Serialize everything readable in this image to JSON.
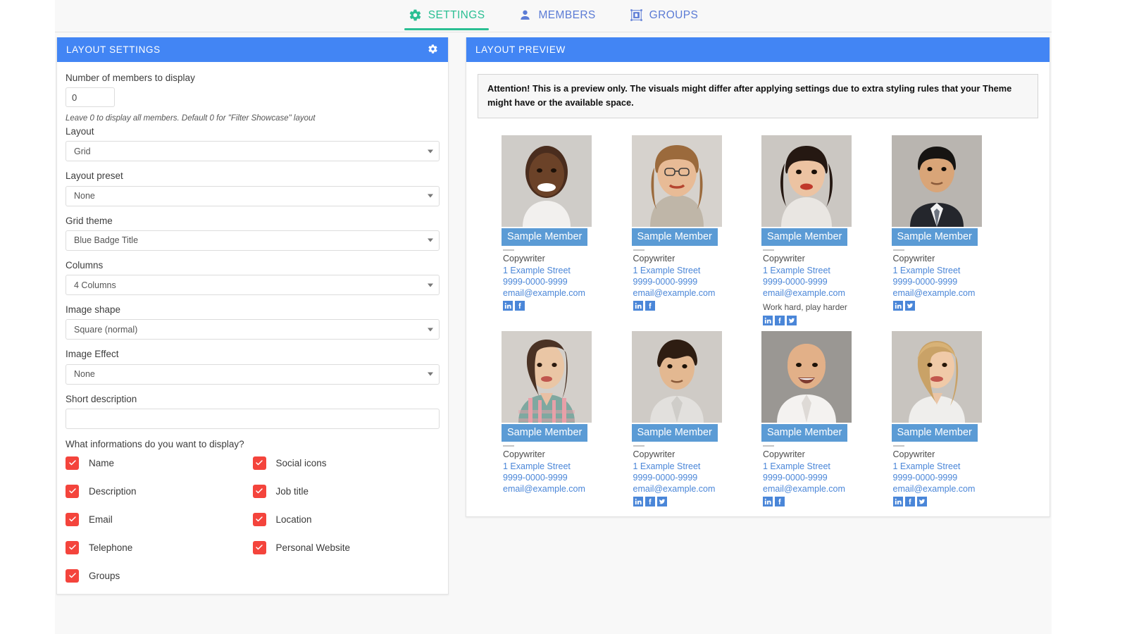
{
  "tabs": [
    {
      "label": "SETTINGS",
      "icon": "gear-icon",
      "active": true
    },
    {
      "label": "MEMBERS",
      "icon": "person-icon",
      "active": false
    },
    {
      "label": "GROUPS",
      "icon": "image-frame-icon",
      "active": false
    }
  ],
  "settings_panel": {
    "title": "LAYOUT SETTINGS",
    "gear_icon": "gear-icon",
    "number_label": "Number of members to display",
    "number_value": "0",
    "number_hint": "Leave 0 to display all members. Default 0 for \"Filter Showcase\" layout",
    "fields": [
      {
        "label": "Layout",
        "value": "Grid"
      },
      {
        "label": "Layout preset",
        "value": "None"
      },
      {
        "label": "Grid theme",
        "value": "Blue Badge Title"
      },
      {
        "label": "Columns",
        "value": "4 Columns"
      },
      {
        "label": "Image shape",
        "value": "Square (normal)"
      },
      {
        "label": "Image Effect",
        "value": "None"
      }
    ],
    "short_description_label": "Short description",
    "short_description_value": "",
    "checkbox_question": "What informations do you want to display?",
    "checkboxes": [
      {
        "label": "Name",
        "checked": true
      },
      {
        "label": "Social icons",
        "checked": true
      },
      {
        "label": "Description",
        "checked": true
      },
      {
        "label": "Job title",
        "checked": true
      },
      {
        "label": "Email",
        "checked": true
      },
      {
        "label": "Location",
        "checked": true
      },
      {
        "label": "Telephone",
        "checked": true
      },
      {
        "label": "Personal Website",
        "checked": true
      },
      {
        "label": "Groups",
        "checked": true
      }
    ]
  },
  "preview_panel": {
    "title": "LAYOUT PREVIEW",
    "notice": "Attention! This is a preview only. The visuals might differ after applying settings due to extra styling rules that your Theme might have or the available space.",
    "members": [
      {
        "name": "Sample Member",
        "job": "Copywriter",
        "address": "1 Example Street",
        "phone": "9999-0000-9999",
        "email": "email@example.com",
        "description": "",
        "socials": [
          "linkedin",
          "facebook"
        ],
        "photo": "man-smiling-white-tshirt"
      },
      {
        "name": "Sample Member",
        "job": "Copywriter",
        "address": "1 Example Street",
        "phone": "9999-0000-9999",
        "email": "email@example.com",
        "description": "",
        "socials": [
          "linkedin",
          "facebook"
        ],
        "photo": "woman-glasses-long-hair"
      },
      {
        "name": "Sample Member",
        "job": "Copywriter",
        "address": "1 Example Street",
        "phone": "9999-0000-9999",
        "email": "email@example.com",
        "description": "Work hard, play harder",
        "socials": [
          "linkedin",
          "facebook",
          "twitter"
        ],
        "photo": "woman-dark-hair-red-lips"
      },
      {
        "name": "Sample Member",
        "job": "Copywriter",
        "address": "1 Example Street",
        "phone": "9999-0000-9999",
        "email": "email@example.com",
        "description": "",
        "socials": [
          "linkedin",
          "twitter"
        ],
        "photo": "man-suit-tie"
      },
      {
        "name": "Sample Member",
        "job": "Copywriter",
        "address": "1 Example Street",
        "phone": "9999-0000-9999",
        "email": "email@example.com",
        "description": "",
        "socials": [],
        "photo": "woman-plaid-shirt"
      },
      {
        "name": "Sample Member",
        "job": "Copywriter",
        "address": "1 Example Street",
        "phone": "9999-0000-9999",
        "email": "email@example.com",
        "description": "",
        "socials": [
          "linkedin",
          "facebook",
          "twitter"
        ],
        "photo": "man-curly-hair-white-shirt"
      },
      {
        "name": "Sample Member",
        "job": "Copywriter",
        "address": "1 Example Street",
        "phone": "9999-0000-9999",
        "email": "email@example.com",
        "description": "",
        "socials": [
          "linkedin",
          "facebook"
        ],
        "photo": "man-bald-white-shirt"
      },
      {
        "name": "Sample Member",
        "job": "Copywriter",
        "address": "1 Example Street",
        "phone": "9999-0000-9999",
        "email": "email@example.com",
        "description": "",
        "socials": [
          "linkedin",
          "facebook",
          "twitter"
        ],
        "photo": "woman-blonde-white-top"
      }
    ]
  },
  "colors": {
    "panel_header": "#4285f4",
    "active_tab": "#2bbf93",
    "inactive_tab": "#5b7bd5",
    "badge": "#5b9bd5",
    "link": "#4a86d8",
    "checkbox": "#f4443c"
  }
}
